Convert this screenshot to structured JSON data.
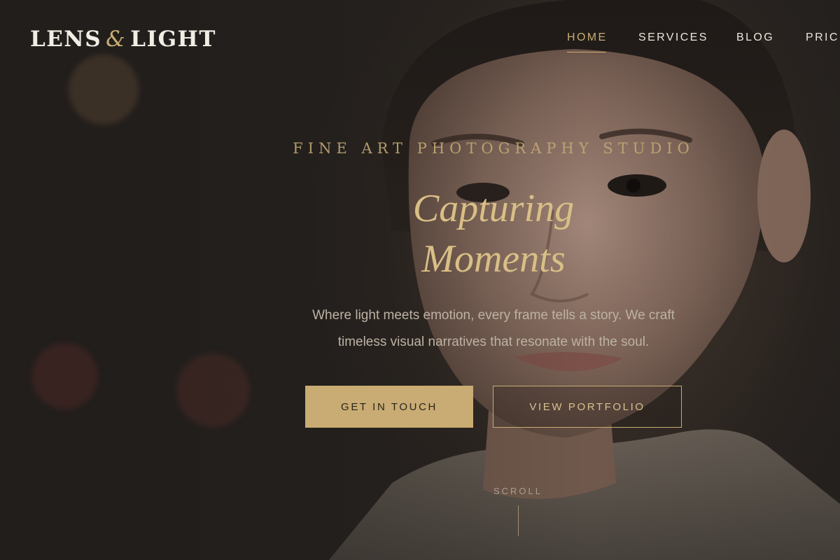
{
  "brand": {
    "name_left": "LENS",
    "ampersand": "&",
    "name_right": "LIGHT"
  },
  "nav": {
    "items": [
      {
        "label": "HOME",
        "active": true
      },
      {
        "label": "SERVICES",
        "active": false
      },
      {
        "label": "BLOG",
        "active": false
      },
      {
        "label": "PRICI",
        "active": false
      }
    ]
  },
  "hero": {
    "eyebrow": "FINE ART PHOTOGRAPHY STUDIO",
    "headline_line1": "Capturing",
    "headline_line2": "Moments",
    "subtext_line1": "Where light meets emotion, every frame tells a story. We craft",
    "subtext_line2": "timeless visual narratives that resonate with the soul.",
    "primary_button": "GET IN TOUCH",
    "secondary_button": "VIEW PORTFOLIO",
    "scroll_label": "SCROLL"
  },
  "colors": {
    "accent_gold": "#c9ac73",
    "background_dark": "#2a2521",
    "text_light": "#f2ede4"
  }
}
